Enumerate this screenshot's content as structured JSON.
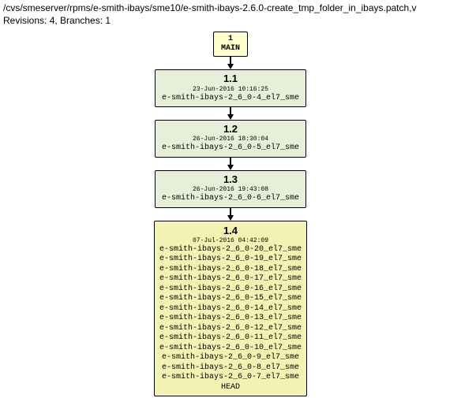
{
  "header": {
    "path": "/cvs/smeserver/rpms/e-smith-ibays/sme10/e-smith-ibays-2.6.0-create_tmp_folder_in_ibays.patch,v",
    "meta": "Revisions: 4, Branches: 1"
  },
  "main": {
    "index": "1",
    "label": "MAIN"
  },
  "revisions": [
    {
      "version": "1.1",
      "timestamp": "23-Jun-2016 10:16:25",
      "tags": [
        "e-smith-ibays-2_6_0-4_el7_sme"
      ]
    },
    {
      "version": "1.2",
      "timestamp": "26-Jun-2016 18:30:04",
      "tags": [
        "e-smith-ibays-2_6_0-5_el7_sme"
      ]
    },
    {
      "version": "1.3",
      "timestamp": "26-Jun-2016 19:43:08",
      "tags": [
        "e-smith-ibays-2_6_0-6_el7_sme"
      ]
    },
    {
      "version": "1.4",
      "timestamp": "07-Jul-2016 04:42:09",
      "tags": [
        "e-smith-ibays-2_6_0-20_el7_sme",
        "e-smith-ibays-2_6_0-19_el7_sme",
        "e-smith-ibays-2_6_0-18_el7_sme",
        "e-smith-ibays-2_6_0-17_el7_sme",
        "e-smith-ibays-2_6_0-16_el7_sme",
        "e-smith-ibays-2_6_0-15_el7_sme",
        "e-smith-ibays-2_6_0-14_el7_sme",
        "e-smith-ibays-2_6_0-13_el7_sme",
        "e-smith-ibays-2_6_0-12_el7_sme",
        "e-smith-ibays-2_6_0-11_el7_sme",
        "e-smith-ibays-2_6_0-10_el7_sme",
        "e-smith-ibays-2_6_0-9_el7_sme",
        "e-smith-ibays-2_6_0-8_el7_sme",
        "e-smith-ibays-2_6_0-7_el7_sme",
        "HEAD"
      ]
    }
  ]
}
